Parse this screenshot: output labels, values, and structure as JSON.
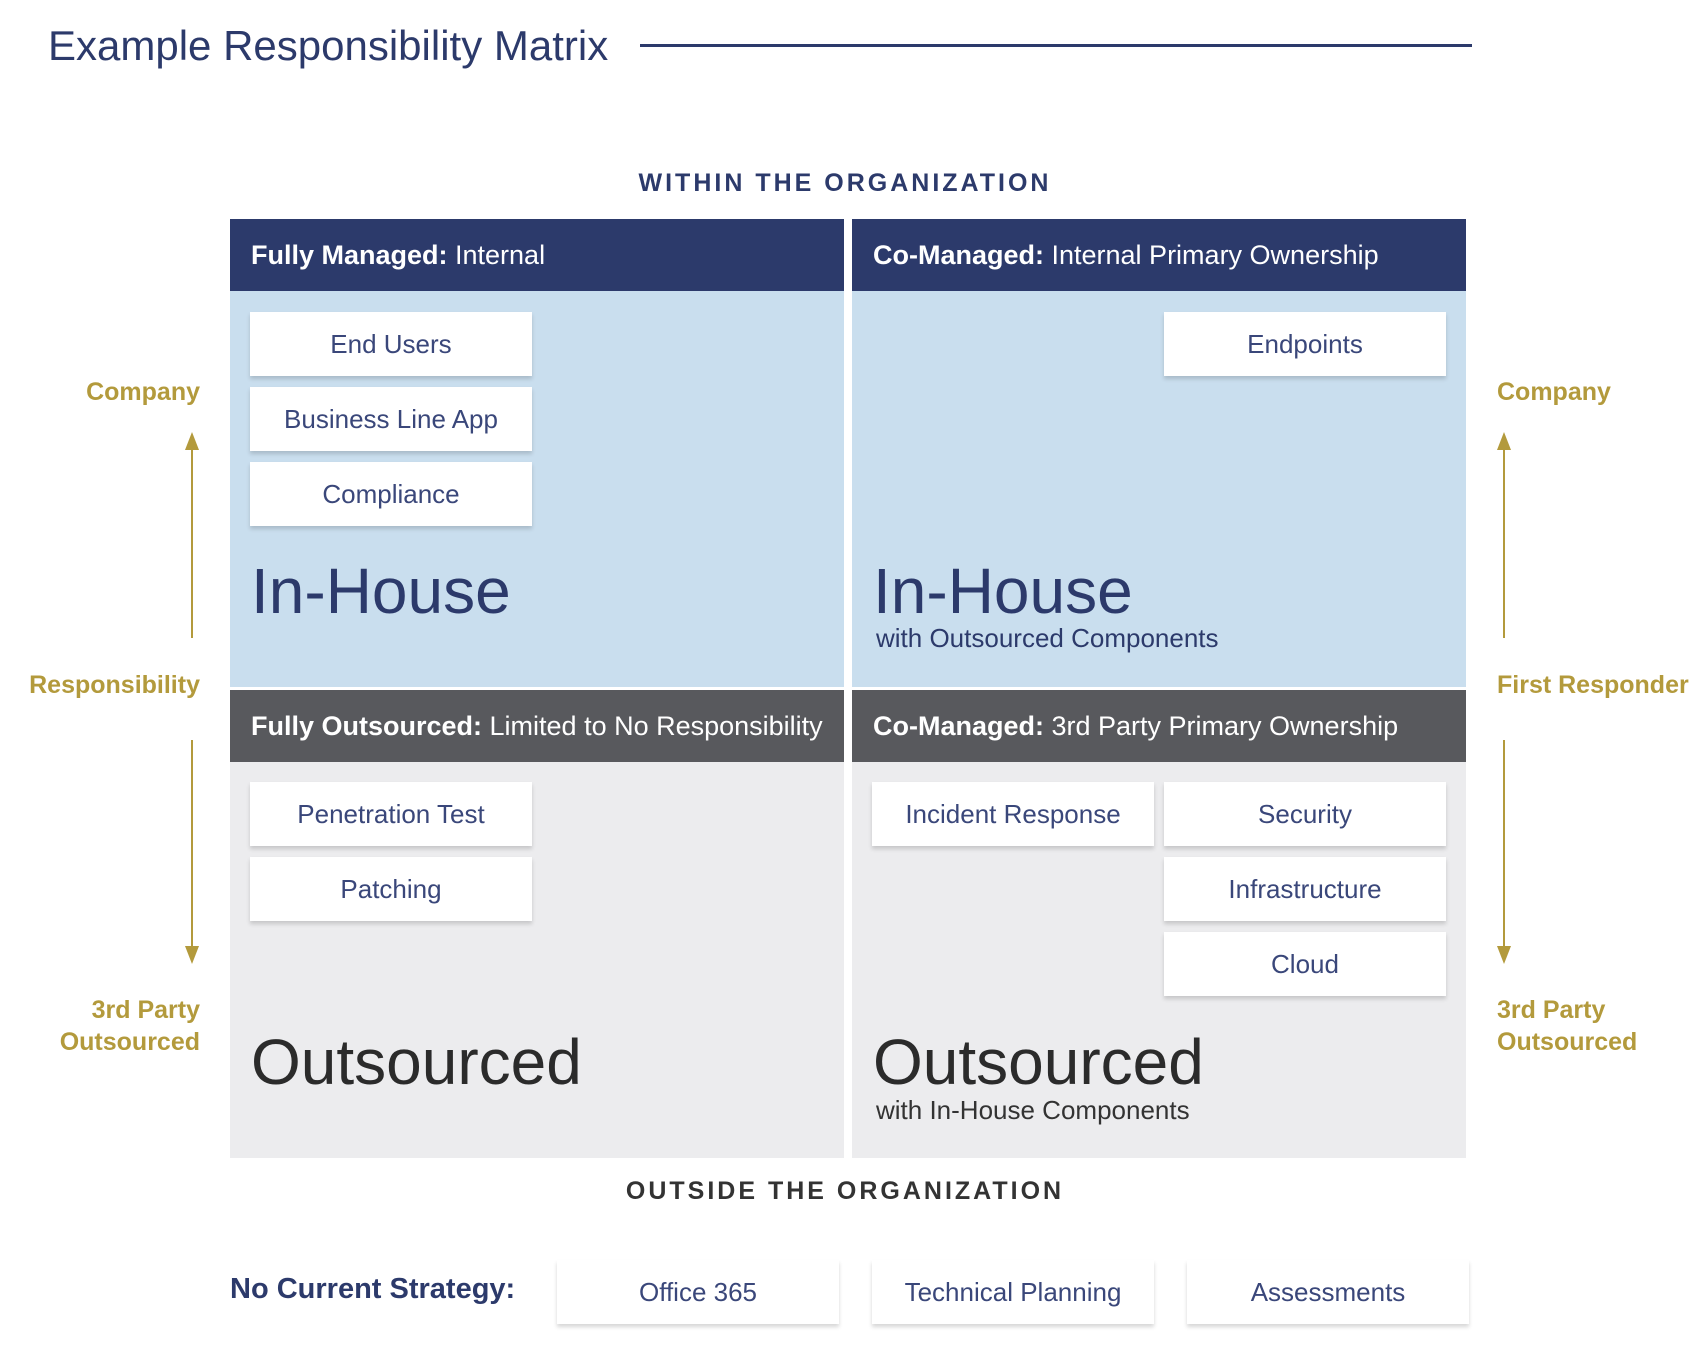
{
  "title": "Example Responsibility Matrix",
  "within_label": "WITHIN THE ORGANIZATION",
  "outside_label": "OUTSIDE THE ORGANIZATION",
  "left_axis": {
    "top": "Company",
    "middle": "Responsibility",
    "bottom_line1": "3rd Party",
    "bottom_line2": "Outsourced"
  },
  "right_axis": {
    "top": "Company",
    "middle": "First Responder",
    "bottom_line1": "3rd Party",
    "bottom_line2": "Outsourced"
  },
  "quadrants": {
    "top_left": {
      "header_bold": "Fully Managed:",
      "header_rest": " Internal",
      "cards": [
        "End Users",
        "Business Line App",
        "Compliance"
      ],
      "big": "In-House",
      "sub": ""
    },
    "top_right": {
      "header_bold": "Co-Managed:",
      "header_rest": " Internal Primary Ownership",
      "cards": [
        "Endpoints"
      ],
      "big": "In-House",
      "sub": "with Outsourced Components"
    },
    "bottom_left": {
      "header_bold": "Fully Outsourced:",
      "header_rest": " Limited to No Responsibility",
      "cards": [
        "Penetration Test",
        "Patching"
      ],
      "big": "Outsourced",
      "sub": ""
    },
    "bottom_right": {
      "header_bold": "Co-Managed:",
      "header_rest": " 3rd Party Primary Ownership",
      "cards": [
        "Incident Response",
        "Security",
        "Infrastructure",
        "Cloud"
      ],
      "big": "Outsourced",
      "sub": "with In-House Components"
    }
  },
  "no_strategy": {
    "label": "No Current Strategy:",
    "items": [
      "Office 365",
      "Technical Planning",
      "Assessments"
    ]
  },
  "colors": {
    "navy": "#2c3a6b",
    "grey_header": "#58595d",
    "light_blue": "#c9deee",
    "light_grey": "#ececee",
    "gold": "#b39a3c"
  }
}
